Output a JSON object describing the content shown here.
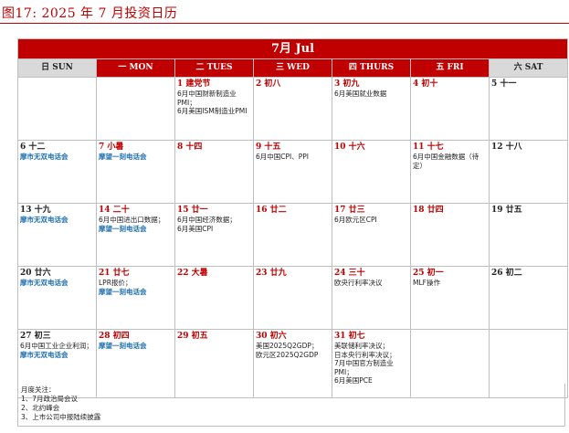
{
  "figure": {
    "title": "图17:   2025 年 7 月投资日历"
  },
  "month_header": "7月 Jul",
  "weekdays": [
    "日 SUN",
    "一 MON",
    "二 TUES",
    "三 WED",
    "四 THURS",
    "五 FRI",
    "六 SAT"
  ],
  "weeks": [
    [
      {
        "num": "",
        "events": []
      },
      {
        "num": "",
        "events": []
      },
      {
        "num": "1 建党节",
        "events": [
          {
            "text": "6月中国财新制造业PMI；",
            "blue": false
          },
          {
            "text": "6月美国ISM制造业PMI",
            "blue": false
          }
        ]
      },
      {
        "num": "2 初八",
        "events": []
      },
      {
        "num": "3 初九",
        "events": [
          {
            "text": "6月美国就业数据",
            "blue": false
          }
        ]
      },
      {
        "num": "4 初十",
        "events": []
      },
      {
        "num": "5 十一",
        "events": []
      }
    ],
    [
      {
        "num": "6 十二",
        "events": [
          {
            "text": "摩市无双电话会",
            "blue": true
          }
        ]
      },
      {
        "num": "7 小暑",
        "events": [
          {
            "text": "摩望一刻电话会",
            "blue": true
          }
        ]
      },
      {
        "num": "8 十四",
        "events": []
      },
      {
        "num": "9 十五",
        "events": [
          {
            "text": "6月中国CPI、PPI",
            "blue": false
          }
        ]
      },
      {
        "num": "10 十六",
        "events": []
      },
      {
        "num": "11 十七",
        "events": [
          {
            "text": "6月中国金融数据（待定）",
            "blue": false
          }
        ]
      },
      {
        "num": "12 十八",
        "events": []
      }
    ],
    [
      {
        "num": "13 十九",
        "events": [
          {
            "text": "摩市无双电话会",
            "blue": true
          }
        ]
      },
      {
        "num": "14 二十",
        "events": [
          {
            "text": "6月中国进出口数据；",
            "blue": false
          },
          {
            "text": "摩望一刻电话会",
            "blue": true
          }
        ]
      },
      {
        "num": "15 廿一",
        "events": [
          {
            "text": "6月中国经济数据；",
            "blue": false
          },
          {
            "text": "6月美国CPI",
            "blue": false
          }
        ]
      },
      {
        "num": "16 廿二",
        "events": []
      },
      {
        "num": "17 廿三",
        "events": [
          {
            "text": "6月欧元区CPI",
            "blue": false
          }
        ]
      },
      {
        "num": "18 廿四",
        "events": []
      },
      {
        "num": "19 廿五",
        "events": []
      }
    ],
    [
      {
        "num": "20 廿六",
        "events": [
          {
            "text": "摩市无双电话会",
            "blue": true
          }
        ]
      },
      {
        "num": "21 廿七",
        "events": [
          {
            "text": "LPR报价；",
            "blue": false
          },
          {
            "text": "摩望一刻电话会",
            "blue": true
          }
        ]
      },
      {
        "num": "22 大暑",
        "events": []
      },
      {
        "num": "23 廿九",
        "events": []
      },
      {
        "num": "24 三十",
        "events": [
          {
            "text": "欧央行利率决议",
            "blue": false
          }
        ]
      },
      {
        "num": "25 初一",
        "events": [
          {
            "text": "MLF操作",
            "blue": false
          }
        ]
      },
      {
        "num": "26 初二",
        "events": []
      }
    ],
    [
      {
        "num": "27 初三",
        "events": [
          {
            "text": "6月中国工业企业利润；",
            "blue": false
          },
          {
            "text": "摩市无双电话会",
            "blue": true
          }
        ]
      },
      {
        "num": "28 初四",
        "events": [
          {
            "text": "摩望一刻电话会",
            "blue": true
          }
        ]
      },
      {
        "num": "29 初五",
        "events": []
      },
      {
        "num": "30 初六",
        "events": [
          {
            "text": "美国2025Q2GDP；",
            "blue": false
          },
          {
            "text": "欧元区2025Q2GDP",
            "blue": false
          }
        ]
      },
      {
        "num": "31 初七",
        "events": [
          {
            "text": "美联储利率决议；",
            "blue": false
          },
          {
            "text": "日本央行利率决议；",
            "blue": false
          },
          {
            "text": "7月中国官方制造业PMI；",
            "blue": false
          },
          {
            "text": "6月美国PCE",
            "blue": false
          }
        ]
      },
      {
        "num": "",
        "events": []
      },
      {
        "num": "",
        "events": []
      }
    ]
  ],
  "notes": {
    "title": "月度关注：",
    "items": [
      "1、7月政治局会议",
      "2、北约峰会",
      "3、上市公司中报陆续披露"
    ]
  },
  "colors": {
    "accent": "#c00000",
    "weekend_header": "#d9d9d9",
    "blue_event": "#1f6fb2"
  }
}
